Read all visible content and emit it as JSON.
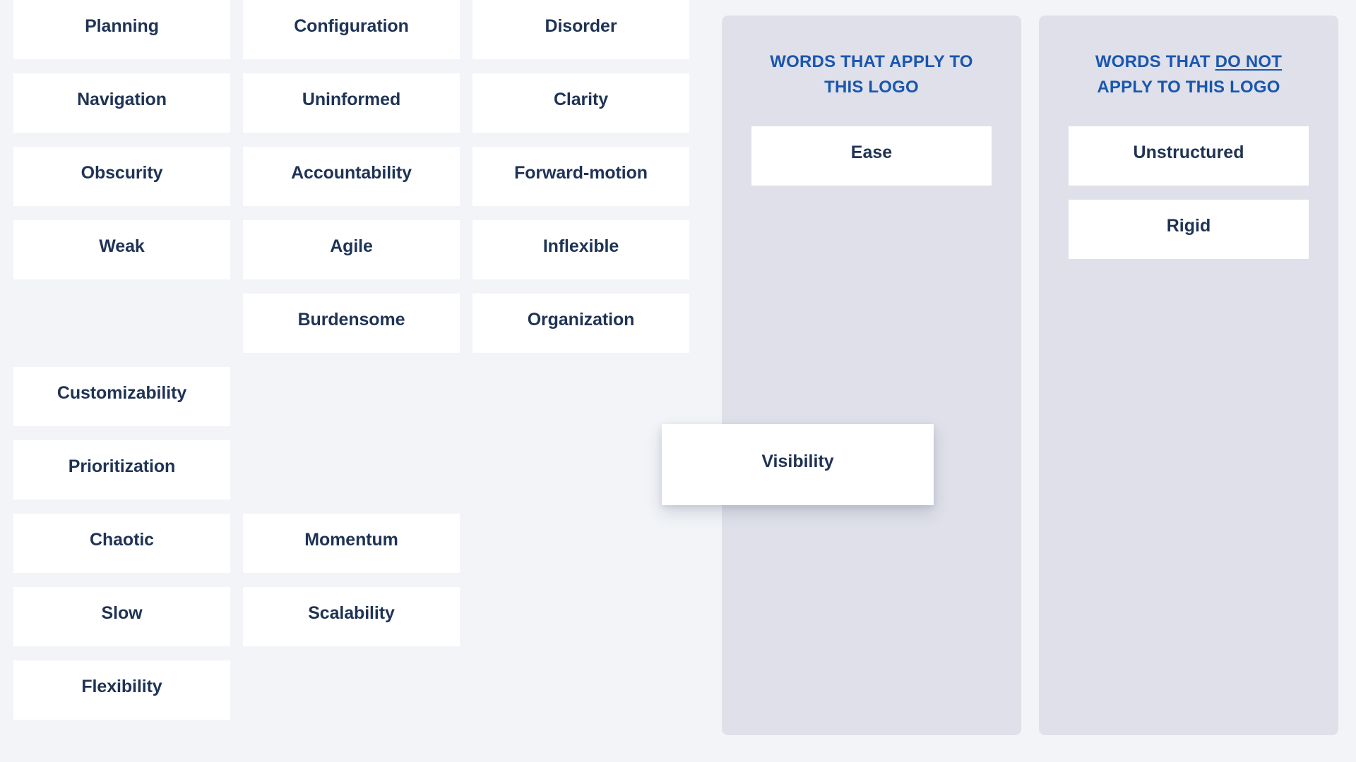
{
  "theme": {
    "page_background": "#f2f4f7",
    "card_background": "#ffffff",
    "panel_background": "#dfe0e9",
    "card_text_color": "#1f3354",
    "panel_title_color": "#1a56ae"
  },
  "word_pool": {
    "columns": [
      {
        "index": 0,
        "cards": [
          {
            "label": "Planning"
          },
          {
            "label": "Navigation"
          },
          {
            "label": "Obscurity"
          },
          {
            "label": "Weak"
          },
          {
            "label": "",
            "spacer": true
          },
          {
            "label": "Customizability"
          },
          {
            "label": "Prioritization"
          },
          {
            "label": "Chaotic"
          },
          {
            "label": "Slow"
          },
          {
            "label": "Flexibility"
          }
        ]
      },
      {
        "index": 1,
        "cards": [
          {
            "label": "Configuration"
          },
          {
            "label": "Uninformed"
          },
          {
            "label": "Accountability"
          },
          {
            "label": "Agile"
          },
          {
            "label": "Burdensome"
          },
          {
            "label": "",
            "spacer": true
          },
          {
            "label": "",
            "spacer": true
          },
          {
            "label": "Momentum"
          },
          {
            "label": "Scalability"
          }
        ]
      },
      {
        "index": 2,
        "cards": [
          {
            "label": "Disorder"
          },
          {
            "label": "Clarity"
          },
          {
            "label": "Forward-motion"
          },
          {
            "label": "Inflexible"
          },
          {
            "label": "Organization"
          }
        ]
      }
    ]
  },
  "panels": [
    {
      "id": "apply",
      "title_parts": [
        {
          "text": "WORDS THAT APPLY TO THIS LOGO",
          "underline": false
        }
      ],
      "title_plain": "WORDS THAT APPLY TO THIS LOGO",
      "cards": [
        {
          "label": "Ease"
        }
      ]
    },
    {
      "id": "not-apply",
      "title_parts": [
        {
          "text": "WORDS THAT ",
          "underline": false
        },
        {
          "text": "DO NOT",
          "underline": true
        },
        {
          "text": " APPLY TO THIS LOGO",
          "underline": false
        }
      ],
      "title_plain": "WORDS THAT DO NOT APPLY TO THIS LOGO",
      "cards": [
        {
          "label": "Unstructured"
        },
        {
          "label": "Rigid"
        }
      ]
    }
  ],
  "dragging_card": {
    "label": "Visibility"
  }
}
